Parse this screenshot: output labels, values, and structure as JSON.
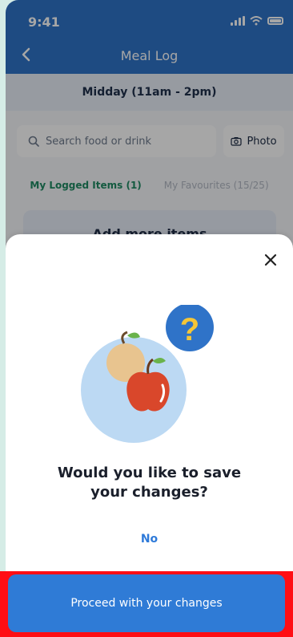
{
  "status": {
    "time": "9:41"
  },
  "nav": {
    "title": "Meal Log",
    "back_icon": "chevron-left-icon"
  },
  "meal": {
    "time_range": "Midday (11am - 2pm)"
  },
  "search": {
    "placeholder": "Search food or drink"
  },
  "photo": {
    "label": "Photo"
  },
  "tabs": [
    {
      "label": "My Logged Items (1)",
      "active": true
    },
    {
      "label": "My Favourites (15/25)",
      "active": false
    }
  ],
  "list": {
    "add_more_label": "Add more items"
  },
  "dialog": {
    "close_icon": "close-icon",
    "question": "Would you like to save your changes?",
    "no_label": "No",
    "proceed_label": "Proceed with your changes"
  },
  "colors": {
    "accent": "#2f7bd6",
    "header": "#2f73c8",
    "highlight": "#ff0e14",
    "active_tab": "#1f8a63"
  }
}
